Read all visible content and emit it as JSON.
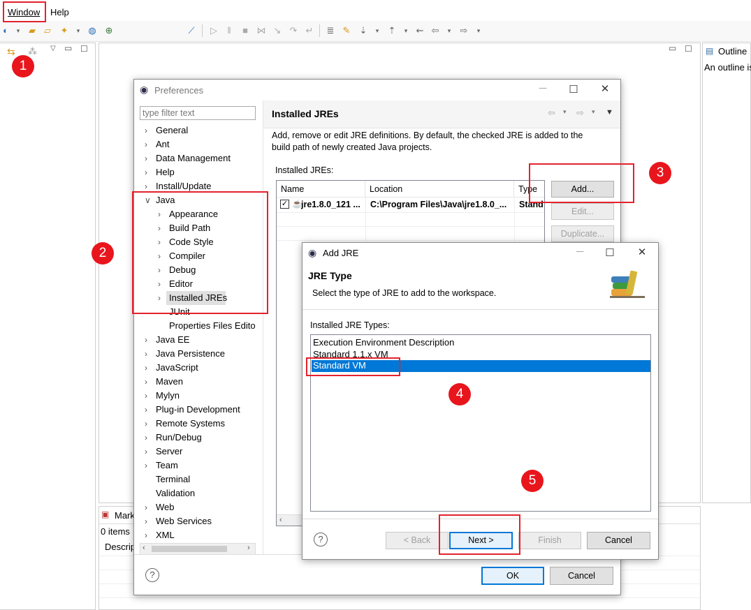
{
  "menubar": {
    "window": "Window",
    "help": "Help"
  },
  "outline": {
    "title": "Outline",
    "message": "An outline is"
  },
  "markers": {
    "tab": "Mark",
    "count": "0 items",
    "col": "Descrip"
  },
  "preferences": {
    "title": "Preferences",
    "filter_placeholder": "type filter text",
    "page_title": "Installed JREs",
    "description_line1": "Add, remove or edit JRE definitions. By default, the checked JRE is added to the",
    "description_line2": "build path of newly created Java projects.",
    "installed_label": "Installed JREs:",
    "table": {
      "headers": [
        "Name",
        "Location",
        "Type"
      ],
      "row": {
        "name": "jre1.8.0_121 ...",
        "location": "C:\\Program Files\\Java\\jre1.8.0_...",
        "type": "Stand"
      }
    },
    "buttons": {
      "add": "Add...",
      "edit": "Edit...",
      "duplicate": "Duplicate...",
      "ok": "OK",
      "cancel": "Cancel"
    },
    "tree": {
      "top": [
        "General",
        "Ant",
        "Data Management",
        "Help",
        "Install/Update"
      ],
      "java": "Java",
      "java_children": [
        "Appearance",
        "Build Path",
        "Code Style",
        "Compiler",
        "Debug",
        "Editor",
        "Installed JREs",
        "JUnit",
        "Properties Files Edito"
      ],
      "rest": [
        "Java EE",
        "Java Persistence",
        "JavaScript",
        "Maven",
        "Mylyn",
        "Plug-in Development",
        "Remote Systems",
        "Run/Debug",
        "Server",
        "Team",
        "Terminal",
        "Validation",
        "Web",
        "Web Services",
        "XML"
      ]
    }
  },
  "addjre": {
    "title": "Add JRE",
    "heading": "JRE Type",
    "subheading": "Select the type of JRE to add to the workspace.",
    "list_label": "Installed JRE Types:",
    "types": [
      "Execution Environment Description",
      "Standard 1.1.x VM",
      "Standard VM"
    ],
    "selected_index": 2,
    "buttons": {
      "back": "< Back",
      "next": "Next >",
      "finish": "Finish",
      "cancel": "Cancel"
    }
  },
  "annotations": [
    "1",
    "2",
    "3",
    "4",
    "5"
  ],
  "colors": {
    "annotation": "#e3222c",
    "selection": "#0078d7",
    "default_button": "#0078d7"
  }
}
